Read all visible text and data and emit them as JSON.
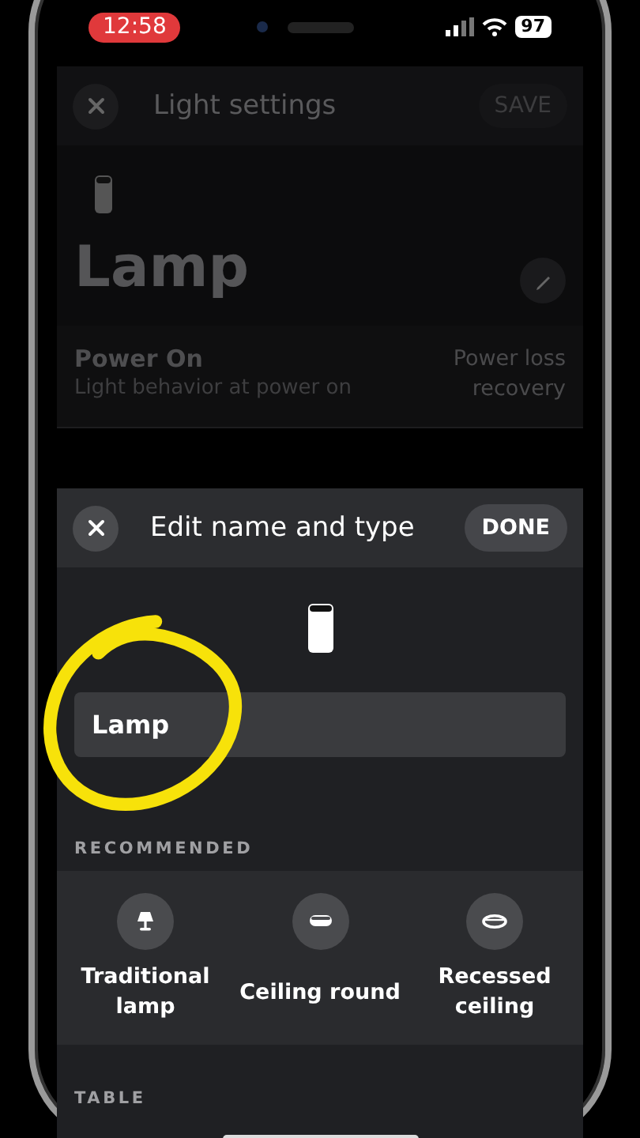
{
  "status_bar": {
    "time": "12:58",
    "battery": "97"
  },
  "background_screen": {
    "title": "Light settings",
    "save_label": "SAVE",
    "device_name": "Lamp",
    "settings": [
      {
        "title": "Power On",
        "subtitle": "Light behavior at power on",
        "value": "Power loss recovery"
      }
    ]
  },
  "sheet": {
    "title": "Edit name and type",
    "done_label": "DONE",
    "name_field": {
      "value": "Lamp"
    },
    "section_label": "RECOMMENDED",
    "types": [
      {
        "label": "Traditional lamp",
        "kind": "table-lamp"
      },
      {
        "label": "Ceiling round",
        "kind": "ceiling-round"
      },
      {
        "label": "Recessed ceiling",
        "kind": "recessed"
      }
    ],
    "next_section_label": "TABLE"
  },
  "annotation": {
    "kind": "circle"
  }
}
